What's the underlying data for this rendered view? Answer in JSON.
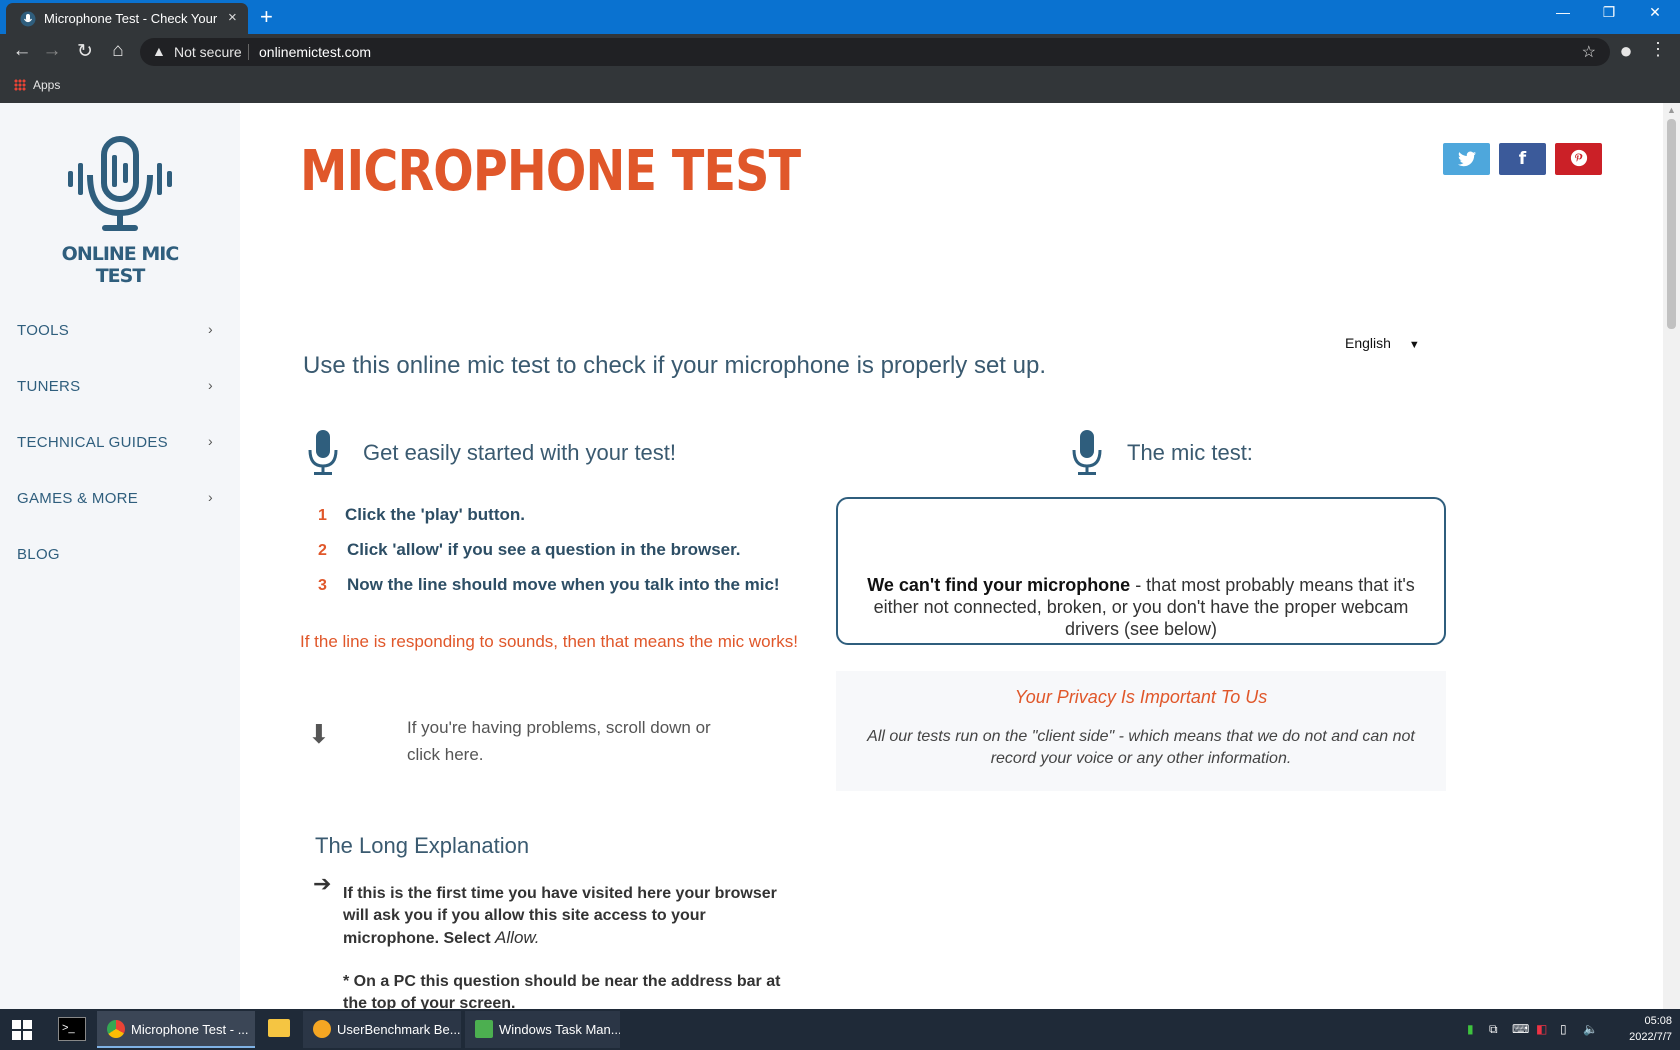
{
  "browser": {
    "tab_title": "Microphone Test - Check Your Mic",
    "new_tab": "+",
    "minimize": "—",
    "restore": "❐",
    "close": "✕",
    "security_label": "Not secure",
    "url": "onlinemictest.com",
    "bookmarks": {
      "apps": "Apps"
    }
  },
  "sidebar": {
    "logo_text": "ONLINE MIC TEST",
    "nav": [
      {
        "label": "TOOLS",
        "has_submenu": true
      },
      {
        "label": "TUNERS",
        "has_submenu": true
      },
      {
        "label": "TECHNICAL GUIDES",
        "has_submenu": true
      },
      {
        "label": "GAMES & MORE",
        "has_submenu": true
      },
      {
        "label": "BLOG",
        "has_submenu": false
      }
    ]
  },
  "main": {
    "title": "MICROPHONE TEST",
    "social": [
      {
        "name": "twitter-icon",
        "glyph": "🐦",
        "color": "#4ea7dc"
      },
      {
        "name": "facebook-icon",
        "glyph": "f",
        "color": "#3b5a9a"
      },
      {
        "name": "pinterest-icon",
        "glyph": "℗",
        "color": "#cb2027"
      }
    ],
    "language": "English",
    "intro": "Use this online mic test to check if your microphone is properly set up.",
    "started_heading": "Get easily started with your test!",
    "steps": [
      {
        "num": "1",
        "text": "Click the 'play' button."
      },
      {
        "num": "2",
        "text": "Click 'allow' if you see a question in the browser."
      },
      {
        "num": "3",
        "text": "Now the line should move when you talk into the mic!"
      }
    ],
    "responding_note": "If the line is responding to sounds, then that means the mic works!",
    "problems_text": "If you're having problems, scroll down or click here.",
    "mic_test_heading": "The mic test:",
    "test_message_bold": "We can't find your microphone",
    "test_message_rest": " - that most probably means that it's either not connected, broken, or you don't have the proper webcam drivers (see below)",
    "privacy_title": "Your Privacy Is Important To Us",
    "privacy_text": "All our tests run on the \"client side\" - which means that we do not and can not record your voice or any other information.",
    "long_heading": "The Long Explanation",
    "long_p1_a": "If this is the first time you have visited here your browser will ask you if you allow this site access to your microphone. Select ",
    "long_p1_allow": "Allow.",
    "long_p2": "* On a PC this question should be near the address bar at the top of your screen."
  },
  "taskbar": {
    "items": [
      {
        "label": "Microphone Test - ...",
        "active": true,
        "icon": "chrome-icon"
      },
      {
        "label": "UserBenchmark Be...",
        "active": false,
        "icon": "userbenchmark-icon"
      },
      {
        "label": "Windows Task Man...",
        "active": false,
        "icon": "task-manager-icon"
      }
    ],
    "time": "05:08",
    "date": "2022/7/7",
    "accent": "#0a72d0"
  }
}
